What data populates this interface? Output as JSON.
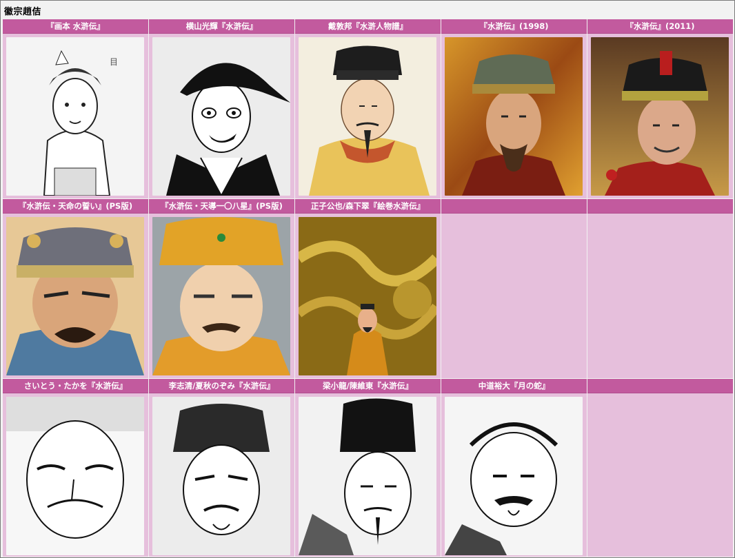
{
  "page": {
    "title": "徽宗趙佶"
  },
  "cells": [
    {
      "caption": "『画本 水滸伝』",
      "style": "ink"
    },
    {
      "caption": "横山光輝『水滸伝』",
      "style": "manga"
    },
    {
      "caption": "戴敦邦『水滸人物譜』",
      "style": "watercolor"
    },
    {
      "caption": "『水滸伝』(1998)",
      "style": "photo-gold"
    },
    {
      "caption": "『水滸伝』(2011)",
      "style": "photo-red"
    },
    {
      "caption": "『水滸伝・天命の誓い』(PS版)",
      "style": "game-crown"
    },
    {
      "caption": "『水滸伝・天導一〇八星』(PS版)",
      "style": "game-yellow"
    },
    {
      "caption": "正子公也/森下翠『絵巻水滸伝』",
      "style": "dragon"
    },
    {
      "caption": "",
      "style": "empty"
    },
    {
      "caption": "",
      "style": "empty"
    },
    {
      "caption": "さいとう・たかを『水滸伝』",
      "style": "manga-bw"
    },
    {
      "caption": "李志清/夏秋のぞみ『水滸伝』",
      "style": "manga-bw"
    },
    {
      "caption": "梁小龍/陳維東『水滸伝』",
      "style": "manga-bw"
    },
    {
      "caption": "中道裕大『月の蛇』",
      "style": "manga-bw"
    },
    {
      "caption": "",
      "style": "empty"
    }
  ]
}
